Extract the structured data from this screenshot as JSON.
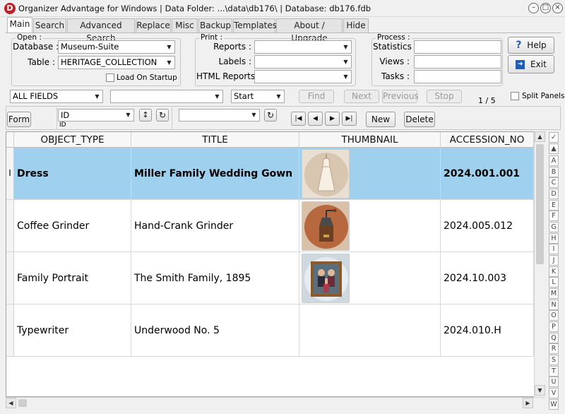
{
  "window": {
    "title": "Organizer Advantage for Windows | Data Folder: ...\\data\\db176\\ | Database: db176.fdb",
    "logo_letter": "D",
    "minimize_glyph": "–",
    "restore_glyph": "□",
    "close_glyph": "×"
  },
  "tabs": [
    "Main",
    "Search",
    "Advanced Search",
    "Replace",
    "Misc",
    "Backup",
    "Templates",
    "About / Upgrade",
    "Hide"
  ],
  "open_group": {
    "title": "Open :",
    "database_label": "Database :",
    "database_value": "Museum-Suite",
    "table_label": "Table :",
    "table_value": "HERITAGE_COLLECTION",
    "load_on_startup_label": "Load On Startup"
  },
  "print_group": {
    "title": "Print :",
    "reports_label": "Reports :",
    "labels_label": "Labels :",
    "html_reports_label": "HTML Reports :"
  },
  "process_group": {
    "title": "Process :",
    "statistics_label": "Statistics :",
    "views_label": "Views :",
    "tasks_label": "Tasks :"
  },
  "side_buttons": {
    "help": "Help",
    "exit": "Exit"
  },
  "search_bar": {
    "field_value": "ALL FIELDS",
    "position_value": "Start",
    "find": "Find",
    "next": "Next",
    "previous": "Previous",
    "stop": "Stop",
    "record_count": "1 / 5",
    "split_panels": "Split Panels"
  },
  "toolbar": {
    "form": "Form",
    "sort_field": "ID",
    "sort_sub": "ID",
    "new": "New",
    "delete": "Delete"
  },
  "grid": {
    "columns": [
      "OBJECT_TYPE",
      "TITLE",
      "THUMBNAIL",
      "ACCESSION_NO"
    ],
    "current_row_marker": "I",
    "rows": [
      {
        "object_type": "Dress",
        "title": "Miller Family Wedding Gown",
        "thumbnail": "wedding-gown",
        "accession_no": "2024.001.001",
        "selected": true
      },
      {
        "object_type": "Coffee Grinder",
        "title": "Hand-Crank Grinder",
        "thumbnail": "coffee-grinder",
        "accession_no": "2024.005.012",
        "selected": false
      },
      {
        "object_type": "Family Portrait",
        "title": "The Smith Family, 1895",
        "thumbnail": "family-portrait",
        "accession_no": "2024.10.003",
        "selected": false
      },
      {
        "object_type": "Typewriter",
        "title": "Underwood No. 5",
        "thumbnail": "",
        "accession_no": "2024.010.H",
        "selected": false
      }
    ]
  },
  "alpha_index": [
    "✓",
    "▲",
    "A",
    "B",
    "C",
    "D",
    "E",
    "F",
    "G",
    "H",
    "I",
    "J",
    "K",
    "L",
    "M",
    "N",
    "O",
    "P",
    "Q",
    "R",
    "S",
    "T",
    "U",
    "V",
    "W"
  ],
  "colors": {
    "selected_row": "#9fd0ee",
    "logo_red": "#c0202a",
    "help_blue": "#1f5fb8"
  }
}
